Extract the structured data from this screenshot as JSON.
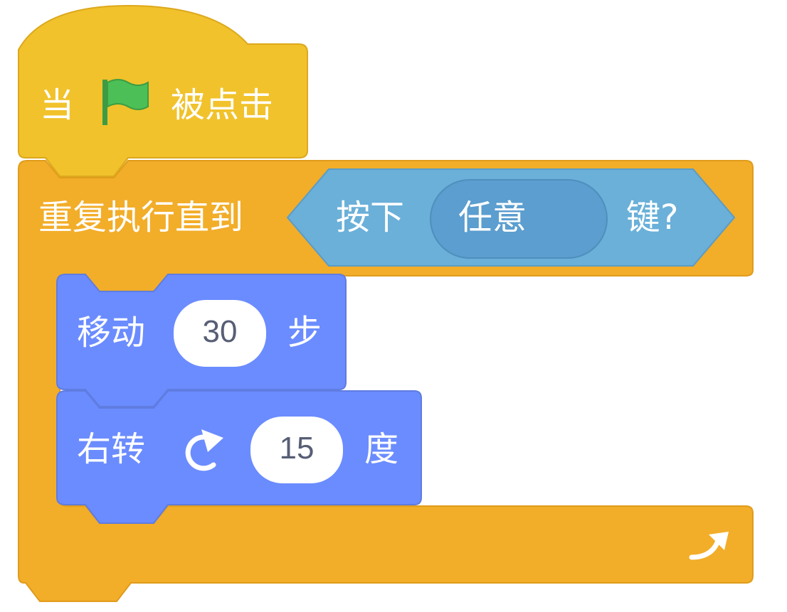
{
  "colors": {
    "events": "#ffc22b",
    "events_dark": "#e6a817",
    "control": "#ffab19",
    "control_dark": "#e69b14",
    "sensing": "#5cb1d6",
    "sensing_light": "#6fb0d9",
    "motion": "#4c97ff",
    "motion_light": "#6b8cff",
    "flag_green": "#4cbf56",
    "text_white": "#ffffff",
    "field_text": "#575e75"
  },
  "event_block": {
    "label_when": "当",
    "flag_icon": "green-flag-icon",
    "label_clicked": "被点击"
  },
  "repeat_block": {
    "label": "重复执行直到",
    "condition": {
      "label_press": "按下",
      "key_option": "任意",
      "dropdown_icon": "chevron-down-icon",
      "label_key": "键?"
    },
    "loop_arrow_icon": "loop-arrow-icon"
  },
  "move_block": {
    "label_move": "移动",
    "steps": "30",
    "label_steps": "步"
  },
  "turn_block": {
    "label_turn": "右转",
    "rotate_icon": "rotate-clockwise-icon",
    "degrees": "15",
    "label_degrees": "度"
  }
}
